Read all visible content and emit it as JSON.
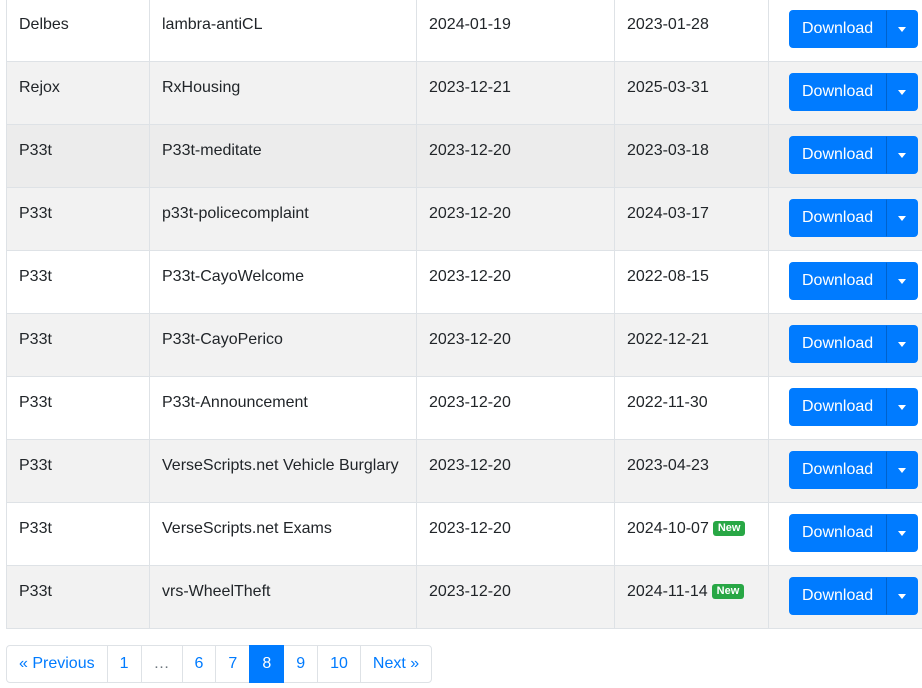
{
  "rows": [
    {
      "author": "Delbes",
      "name": "lambra-antiCL",
      "date1": "2024-01-19",
      "date2": "2023-01-28",
      "badge": "",
      "download_label": "Download"
    },
    {
      "author": "Rejox",
      "name": "RxHousing",
      "date1": "2023-12-21",
      "date2": "2025-03-31",
      "badge": "",
      "download_label": "Download"
    },
    {
      "author": "P33t",
      "name": "P33t-meditate",
      "date1": "2023-12-20",
      "date2": "2023-03-18",
      "badge": "",
      "download_label": "Download"
    },
    {
      "author": "P33t",
      "name": "p33t-policecomplaint",
      "date1": "2023-12-20",
      "date2": "2024-03-17",
      "badge": "",
      "download_label": "Download"
    },
    {
      "author": "P33t",
      "name": "P33t-CayoWelcome",
      "date1": "2023-12-20",
      "date2": "2022-08-15",
      "badge": "",
      "download_label": "Download"
    },
    {
      "author": "P33t",
      "name": "P33t-CayoPerico",
      "date1": "2023-12-20",
      "date2": "2022-12-21",
      "badge": "",
      "download_label": "Download"
    },
    {
      "author": "P33t",
      "name": "P33t-Announcement",
      "date1": "2023-12-20",
      "date2": "2022-11-30",
      "badge": "",
      "download_label": "Download"
    },
    {
      "author": "P33t",
      "name": "VerseScripts.net Vehicle Burglary",
      "date1": "2023-12-20",
      "date2": "2023-04-23",
      "badge": "",
      "download_label": "Download"
    },
    {
      "author": "P33t",
      "name": "VerseScripts.net Exams",
      "date1": "2023-12-20",
      "date2": "2024-10-07",
      "badge": "New",
      "download_label": "Download"
    },
    {
      "author": "P33t",
      "name": "vrs-WheelTheft",
      "date1": "2023-12-20",
      "date2": "2024-11-14",
      "badge": "New",
      "download_label": "Download"
    }
  ],
  "pagination": {
    "previous_label": "« Previous",
    "pages": [
      "1",
      "…",
      "6",
      "7",
      "8",
      "9",
      "10"
    ],
    "active_page": "8",
    "next_label": "Next »"
  },
  "colors": {
    "primary": "#007bff",
    "badge_new": "#28a745",
    "row_stripe": "#f2f2f2",
    "border": "#dee2e6"
  },
  "icons": {
    "dropdown_toggle": "caret-down-icon"
  }
}
